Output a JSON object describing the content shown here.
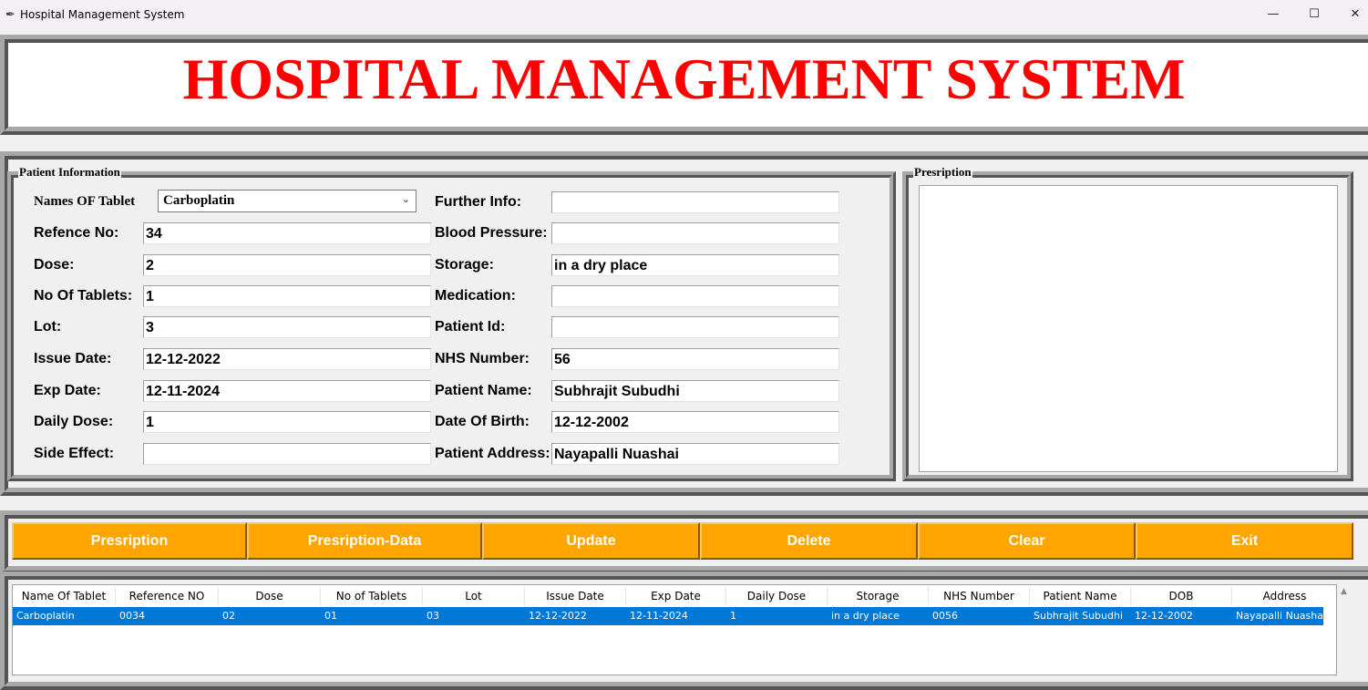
{
  "window": {
    "title": "Hospital Management System",
    "icon": "feather-icon"
  },
  "header": {
    "title": "HOSPITAL MANAGEMENT SYSTEM",
    "color": "#ff0000"
  },
  "patient_info": {
    "group_title": "Patient Information",
    "tablet_label": "Names OF Tablet",
    "tablet_value": "Carboplatin",
    "left_fields": [
      {
        "label": "Refence No:",
        "value": "34"
      },
      {
        "label": "Dose:",
        "value": "2"
      },
      {
        "label": "No Of Tablets:",
        "value": "1"
      },
      {
        "label": "Lot:",
        "value": "3"
      },
      {
        "label": "Issue Date:",
        "value": "12-12-2022"
      },
      {
        "label": "Exp Date:",
        "value": "12-11-2024"
      },
      {
        "label": "Daily Dose:",
        "value": "1"
      },
      {
        "label": "Side Effect:",
        "value": ""
      }
    ],
    "right_fields": [
      {
        "label": "Further Info:",
        "value": ""
      },
      {
        "label": "Blood Pressure:",
        "value": ""
      },
      {
        "label": "Storage:",
        "value": "in a dry place"
      },
      {
        "label": "Medication:",
        "value": ""
      },
      {
        "label": "Patient Id:",
        "value": ""
      },
      {
        "label": "NHS Number:",
        "value": "56"
      },
      {
        "label": "Patient Name:",
        "value": "Subhrajit Subudhi"
      },
      {
        "label": "Date Of Birth:",
        "value": "12-12-2002"
      },
      {
        "label": "Patient Address:",
        "value": "Nayapalli Nuashai"
      }
    ]
  },
  "prescription": {
    "group_title": "Presription",
    "text": ""
  },
  "buttons": [
    "Presription",
    "Presription-Data",
    "Update",
    "Delete",
    "Clear",
    "Exit"
  ],
  "button_color": "#ffa500",
  "table": {
    "columns": [
      "Name Of Tablet",
      "Reference NO",
      "Dose",
      "No of Tablets",
      "Lot",
      "Issue Date",
      "Exp Date",
      "Daily Dose",
      "Storage",
      "NHS Number",
      "Patient Name",
      "DOB",
      "Address"
    ],
    "rows": [
      [
        "Carboplatin",
        "0034",
        "02",
        "01",
        "03",
        "12-12-2022",
        "12-11-2024",
        "1",
        "in a dry place",
        "0056",
        "Subhrajit Subudhi",
        "12-12-2002",
        "Nayapalli Nuashai"
      ]
    ],
    "selected_color": "#0078d7"
  }
}
